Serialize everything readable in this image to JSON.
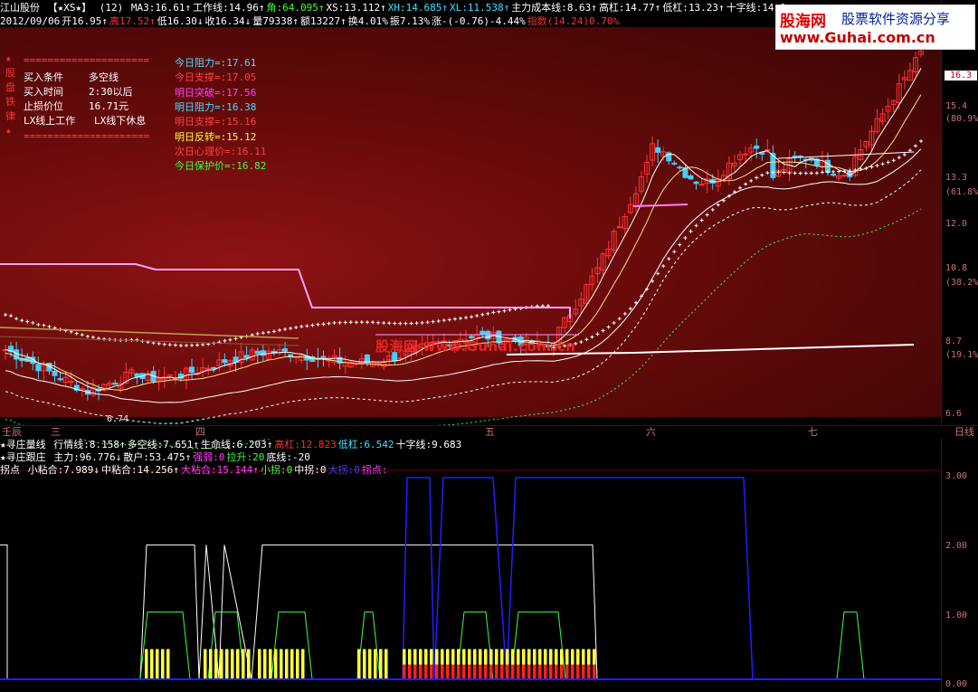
{
  "header": {
    "stock_name": "江山股份",
    "indicator_name": "【★XS★】",
    "params": "(12)",
    "line1": [
      {
        "label": "MA3:",
        "value": "16.61",
        "arrow": "↑",
        "color": "#ffffff"
      },
      {
        "label": "工作线:",
        "value": "14.96",
        "arrow": "↑",
        "color": "#ffffff"
      },
      {
        "label": "角:",
        "value": "64.095",
        "arrow": "↑",
        "color": "#40ff40"
      },
      {
        "label": "XS:",
        "value": "13.112",
        "arrow": "↑",
        "color": "#ffffff"
      },
      {
        "label": "XH:",
        "value": "14.685",
        "arrow": "↑",
        "color": "#40e0ff"
      },
      {
        "label": "XL:",
        "value": "11.538",
        "arrow": "↑",
        "color": "#40e0ff"
      },
      {
        "label": "主力成本线:",
        "value": "8.63",
        "arrow": "↑",
        "color": "#ffffff"
      },
      {
        "label": "高杠:",
        "value": "14.77",
        "arrow": "↑",
        "color": "#ffffff"
      },
      {
        "label": "低杠:",
        "value": "13.23",
        "arrow": "↑",
        "color": "#ffffff"
      },
      {
        "label": "十字线:",
        "value": "14.0",
        "arrow": "",
        "color": "#ffffff"
      }
    ],
    "line2": [
      {
        "label": "2012/09/06",
        "value": "",
        "color": "#ffffff"
      },
      {
        "label": "开",
        "value": "16.95",
        "arrow": "↑",
        "color": "#ffffff"
      },
      {
        "label": "高",
        "value": "17.52",
        "arrow": "↑",
        "color": "#ff3030"
      },
      {
        "label": "低",
        "value": "16.30",
        "arrow": "↓",
        "color": "#ffffff"
      },
      {
        "label": "收",
        "value": "16.34",
        "arrow": "↓",
        "color": "#ffffff"
      },
      {
        "label": "量",
        "value": "79338",
        "arrow": "↑",
        "color": "#ffffff"
      },
      {
        "label": "额",
        "value": "13227",
        "arrow": "↑",
        "color": "#ffffff"
      },
      {
        "label": "换",
        "value": "4.01%",
        "arrow": "",
        "color": "#ffffff"
      },
      {
        "label": "振",
        "value": "7.13%",
        "arrow": "",
        "color": "#ffffff"
      },
      {
        "label": "涨",
        "value": "-(-0.76)-4.44%",
        "arrow": "",
        "color": "#ffffff"
      },
      {
        "label": "指数",
        "value": "(14.24)0.70%",
        "arrow": "",
        "color": "#ff3030"
      }
    ]
  },
  "logo": {
    "brand": "股海网",
    "tagline": "股票软件资源分享",
    "url": "www.Guhai.com.cn"
  },
  "watermark": "股海网  www.Guhai.com.cn",
  "left_panel": {
    "side_chars": [
      "★",
      "股",
      "盘",
      "铁",
      "律",
      "★"
    ],
    "divider": "=====================",
    "rows": [
      {
        "label": "买入条件",
        "value": "多空线"
      },
      {
        "label": "买入时间",
        "value": "2:30以后"
      },
      {
        "label": "止损价位",
        "value": "16.71元"
      },
      {
        "label": "LX线上工作",
        "value": "LX线下休息"
      }
    ]
  },
  "levels": [
    {
      "label": "今日阻力=:",
      "value": "17.61",
      "color": "#40e0ff"
    },
    {
      "label": "今日支撑=:",
      "value": "17.05",
      "color": "#ff4040"
    },
    {
      "label": "明日突破=:",
      "value": "17.56",
      "color": "#ff40ff"
    },
    {
      "label": "明日阻力=:",
      "value": "16.38",
      "color": "#40e0ff"
    },
    {
      "label": "明日支撑=:",
      "value": "15.16",
      "color": "#ff4040"
    },
    {
      "label": "明日反转=:",
      "value": "15.12",
      "color": "#ffff40"
    },
    {
      "label": "次日心理价=:",
      "value": "16.11",
      "color": "#ff4040"
    },
    {
      "label": "今日保护价=:",
      "value": "16.82",
      "color": "#40ff40"
    }
  ],
  "price_axis": [
    {
      "label": "16.3",
      "boxed": true
    },
    {
      "label": "15.4"
    },
    {
      "label": "(80.9%"
    },
    {
      "label": "13.3"
    },
    {
      "label": "(61.8%"
    },
    {
      "label": "12.0"
    },
    {
      "label": "10.8"
    },
    {
      "label": "(38.2%"
    },
    {
      "label": "8.7"
    },
    {
      "label": "(19.1%"
    },
    {
      "label": "6.6"
    }
  ],
  "low_marker": "6.74",
  "date_axis": {
    "months": [
      "壬辰",
      "三",
      "四",
      "五",
      "六",
      "七"
    ],
    "period": "日线"
  },
  "sub1": {
    "title": "★寻庄量线",
    "items": [
      {
        "label": "行情线:",
        "value": "8.158",
        "arrow": "↑",
        "color": "#ffffff"
      },
      {
        "label": "多空线:",
        "value": "7.651",
        "arrow": "↑",
        "color": "#ffffff"
      },
      {
        "label": "生命线:",
        "value": "6.203",
        "arrow": "↑",
        "color": "#ffffff"
      },
      {
        "label": "高杠:",
        "value": "12.823",
        "arrow": "",
        "color": "#ff3030"
      },
      {
        "label": "低杠:",
        "value": "6.542",
        "arrow": "",
        "color": "#40e0ff"
      },
      {
        "label": "十字线:",
        "value": "9.683",
        "arrow": "",
        "color": "#ffffff"
      }
    ]
  },
  "sub2": {
    "title": "★寻庄跟庄",
    "items": [
      {
        "label": "主力:",
        "value": "96.776",
        "arrow": "↓",
        "color": "#ffffff"
      },
      {
        "label": "散户:",
        "value": "53.475",
        "arrow": "↑",
        "color": "#ffffff"
      },
      {
        "label": "强弱:",
        "value": "0",
        "arrow": "",
        "color": "#ff40ff"
      },
      {
        "label": "拉升:",
        "value": "20",
        "arrow": "",
        "color": "#40ff40"
      },
      {
        "label": "底线:",
        "value": "-20",
        "arrow": "",
        "color": "#ffffff"
      }
    ]
  },
  "sub3": {
    "title": "拐点",
    "items": [
      {
        "label": "小粘合:",
        "value": "7.989",
        "arrow": "↓",
        "color": "#ffffff"
      },
      {
        "label": "中粘合:",
        "value": "14.256",
        "arrow": "↑",
        "color": "#ffffff"
      },
      {
        "label": "大粘合:",
        "value": "15.144",
        "arrow": "↑",
        "color": "#ff40ff"
      },
      {
        "label": "小拐:",
        "value": "0",
        "arrow": "",
        "color": "#40ff40"
      },
      {
        "label": "中拐:",
        "value": "0",
        "arrow": "",
        "color": "#ffffff"
      },
      {
        "label": "大拐:",
        "value": "0",
        "arrow": "",
        "color": "#4040ff"
      },
      {
        "label": "拐点:",
        "value": "",
        "arrow": "",
        "color": "#ff40ff"
      }
    ]
  },
  "bottom_axis": [
    "3.00",
    "2.00",
    "1.00",
    "0.00"
  ],
  "colors": {
    "up": "#ff3333",
    "down": "#40d0ff",
    "ma_white": "#ffffff",
    "pink": "#ffa0ff",
    "yellow": "#ffff40",
    "green": "#40ff40",
    "blue": "#2020ff"
  }
}
